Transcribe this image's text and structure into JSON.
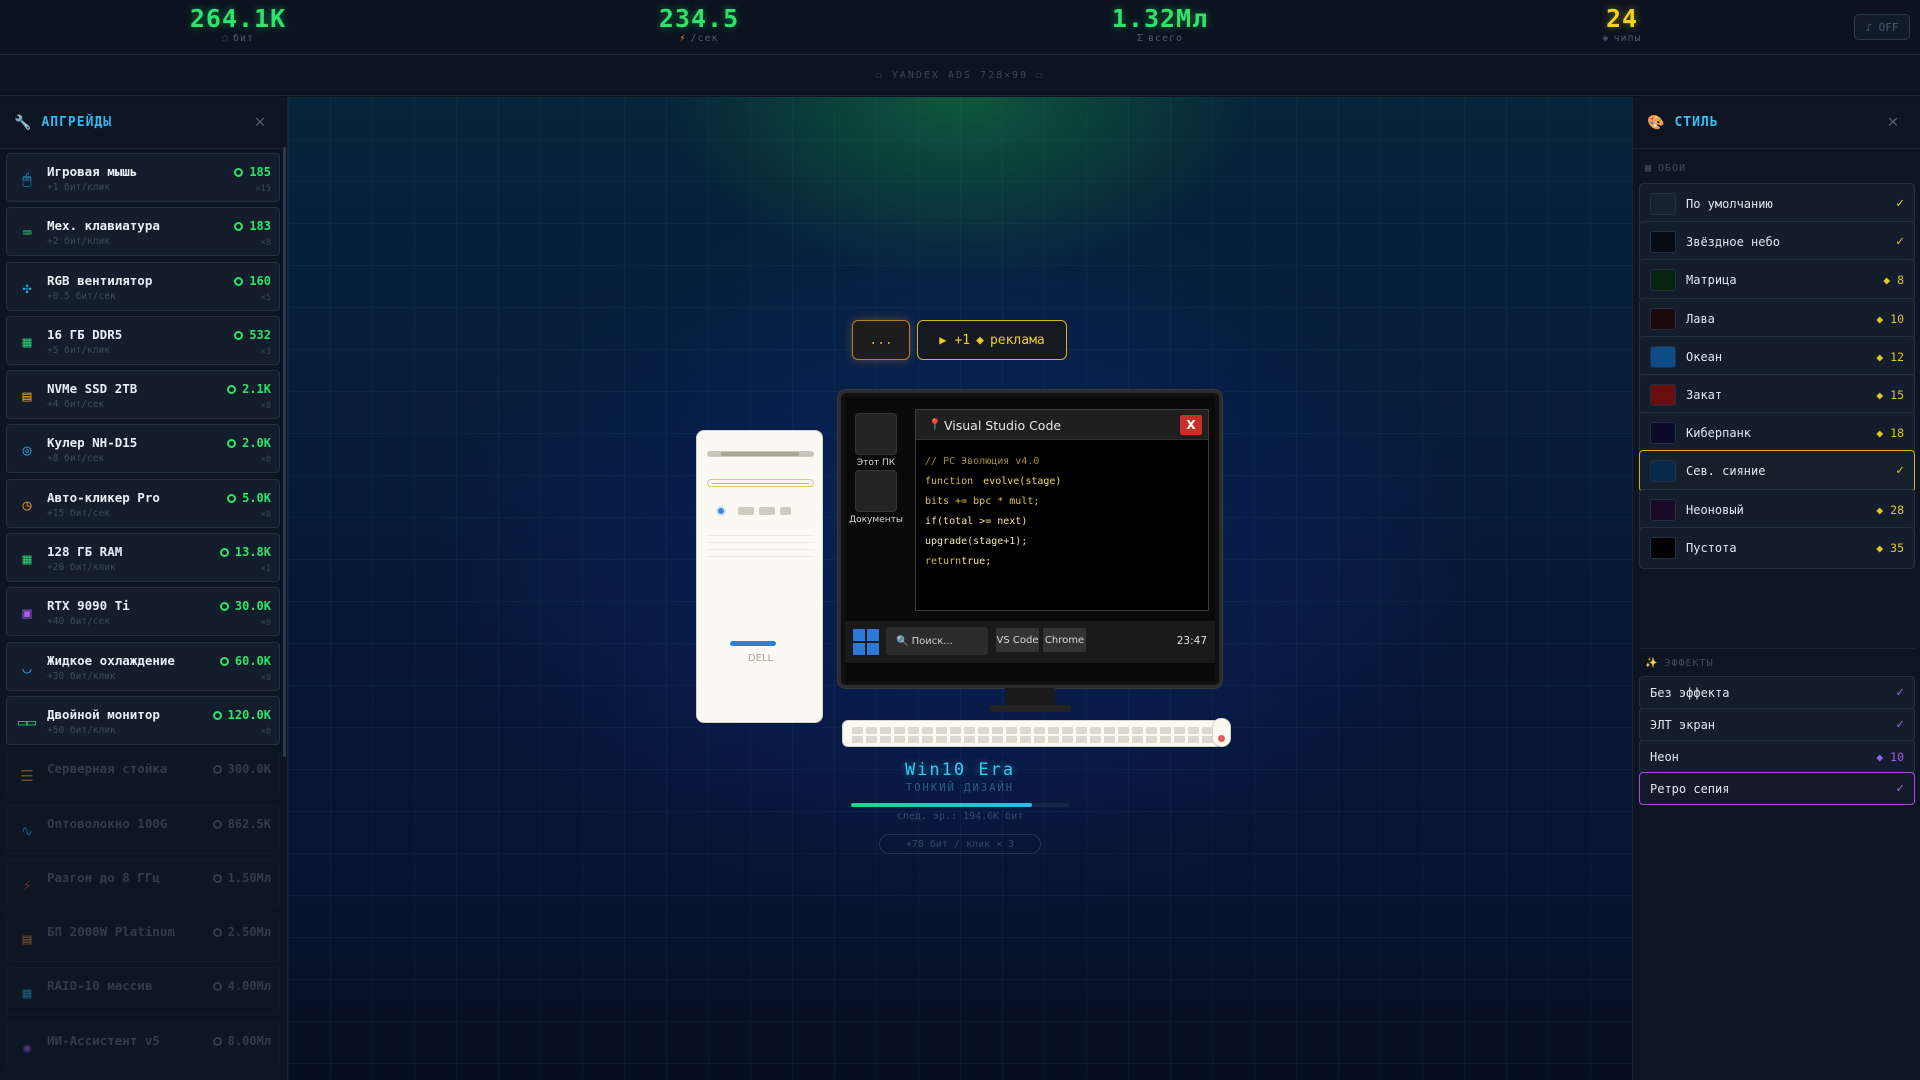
{
  "stats": [
    {
      "value": "264.1K",
      "icon": "◌",
      "label": "бит",
      "color": "#2fe36a"
    },
    {
      "value": "234.5",
      "icon": "⚡",
      "label": "/сек",
      "color": "#2fe36a"
    },
    {
      "value": "1.32Мл",
      "icon": "Σ",
      "label": "всего",
      "color": "#2fe36a"
    },
    {
      "value": "24",
      "icon": "◈",
      "label": "чипы",
      "color": "#f4d21c"
    }
  ],
  "off_button": "♪ OFF",
  "ad_banner": "☐ YANDEX ADS 728×90 ☐",
  "upgrades_panel": {
    "title": "АПГРЕЙДЫ",
    "icon": "wrench-icon",
    "items": [
      {
        "name": "Игровая мышь",
        "sub": "+1 бит/клик",
        "cost": "185",
        "owned": "×15",
        "icon": "mouse-icon",
        "icon_char": "🖱",
        "icon_color": "#2aa7e0",
        "locked": false
      },
      {
        "name": "Мех. клавиатура",
        "sub": "+2 бит/клик",
        "cost": "183",
        "owned": "×8",
        "icon": "keyboard-icon",
        "icon_char": "⌨",
        "icon_color": "#2fc06a",
        "locked": false
      },
      {
        "name": "RGB вентилятор",
        "sub": "+0.5 бит/сек",
        "cost": "160",
        "owned": "×5",
        "icon": "fan-icon",
        "icon_char": "✣",
        "icon_color": "#2aa7e0",
        "locked": false
      },
      {
        "name": "16 ГБ DDR5",
        "sub": "+5 бит/клик",
        "cost": "532",
        "owned": "×3",
        "icon": "ram-icon",
        "icon_char": "▦",
        "icon_color": "#2fc06a",
        "locked": false
      },
      {
        "name": "NVMe SSD 2TB",
        "sub": "+4 бит/сек",
        "cost": "2.1K",
        "owned": "×8",
        "icon": "ssd-icon",
        "icon_char": "▤",
        "icon_color": "#e8962a",
        "locked": false
      },
      {
        "name": "Кулер NH-D15",
        "sub": "+8 бит/сек",
        "cost": "2.0K",
        "owned": "×0",
        "icon": "cooler-icon",
        "icon_char": "◎",
        "icon_color": "#2aa7e0",
        "locked": false
      },
      {
        "name": "Авто-кликер Pro",
        "sub": "+15 бит/сек",
        "cost": "5.0K",
        "owned": "×0",
        "icon": "autoclicker-icon",
        "icon_char": "◷",
        "icon_color": "#e8962a",
        "locked": false
      },
      {
        "name": "128 ГБ RAM",
        "sub": "+20 бит/клик",
        "cost": "13.8K",
        "owned": "×1",
        "icon": "ram-icon",
        "icon_char": "▦",
        "icon_color": "#2fc06a",
        "locked": false
      },
      {
        "name": "RTX 9090 Ti",
        "sub": "+40 бит/сек",
        "cost": "30.0K",
        "owned": "×0",
        "icon": "gpu-icon",
        "icon_char": "▣",
        "icon_color": "#a65ce8",
        "locked": false
      },
      {
        "name": "Жидкое охлаждение",
        "sub": "+30 бит/клик",
        "cost": "60.0K",
        "owned": "×0",
        "icon": "liquid-cooling-icon",
        "icon_char": "◡",
        "icon_color": "#2aa7e0",
        "locked": false
      },
      {
        "name": "Двойной монитор",
        "sub": "+50 бит/клик",
        "cost": "120.0K",
        "owned": "×0",
        "icon": "dual-monitor-icon",
        "icon_char": "▭▭",
        "icon_color": "#2fc06a",
        "locked": false
      },
      {
        "name": "Серверная стойка",
        "sub": "",
        "cost": "300.0K",
        "owned": "",
        "icon": "server-rack-icon",
        "icon_char": "☰",
        "icon_color": "#e8962a",
        "locked": true
      },
      {
        "name": "Оптоволокно 100G",
        "sub": "",
        "cost": "862.5K",
        "owned": "",
        "icon": "fiber-icon",
        "icon_char": "∿",
        "icon_color": "#2aa7e0",
        "locked": true
      },
      {
        "name": "Разгон до 8 ГГц",
        "sub": "",
        "cost": "1.50Мл",
        "owned": "",
        "icon": "overclock-icon",
        "icon_char": "⚡",
        "icon_color": "#e84a4a",
        "locked": true
      },
      {
        "name": "БП 2000W Platinum",
        "sub": "",
        "cost": "2.50Мл",
        "owned": "",
        "icon": "psu-icon",
        "icon_char": "▤",
        "icon_color": "#e8962a",
        "locked": true
      },
      {
        "name": "RAID-10 массив",
        "sub": "",
        "cost": "4.00Мл",
        "owned": "",
        "icon": "raid-icon",
        "icon_char": "▦",
        "icon_color": "#2aa7e0",
        "locked": true
      },
      {
        "name": "ИИ-Ассистент v5",
        "sub": "",
        "cost": "8.00Мл",
        "owned": "",
        "icon": "ai-assistant-icon",
        "icon_char": "✺",
        "icon_color": "#a65ce8",
        "locked": true
      }
    ]
  },
  "style_panel": {
    "title": "СТИЛЬ",
    "icon": "palette-icon",
    "wallpapers_label": "ОБОИ",
    "effects_label": "ЭФФЕКТЫ",
    "wallpapers": [
      {
        "name": "По умолчанию",
        "status": "✓",
        "owned": true,
        "active": false,
        "swatch": "#162230"
      },
      {
        "name": "Звёздное небо",
        "status": "✓",
        "owned": true,
        "active": false,
        "swatch": "#070b16"
      },
      {
        "name": "Матрица",
        "status": "◆ 8",
        "owned": false,
        "active": false,
        "swatch": "#062410"
      },
      {
        "name": "Лава",
        "status": "◆ 10",
        "owned": false,
        "active": false,
        "swatch": "#1e0a0a"
      },
      {
        "name": "Океан",
        "status": "◆ 12",
        "owned": false,
        "active": false,
        "swatch": "#0f4b86"
      },
      {
        "name": "Закат",
        "status": "◆ 15",
        "owned": false,
        "active": false,
        "swatch": "#6a0f0f"
      },
      {
        "name": "Киберпанк",
        "status": "◆ 18",
        "owned": false,
        "active": false,
        "swatch": "#0e0a2a"
      },
      {
        "name": "Сев. сияние",
        "status": "✓",
        "owned": true,
        "active": true,
        "swatch": "#0a2a4a"
      },
      {
        "name": "Неоновый",
        "status": "◆ 28",
        "owned": false,
        "active": false,
        "swatch": "#1a0a2a"
      },
      {
        "name": "Пустота",
        "status": "◆ 35",
        "owned": false,
        "active": false,
        "swatch": "#020202"
      }
    ],
    "effects": [
      {
        "name": "Без эффекта",
        "status": "✓",
        "owned": true,
        "active": false
      },
      {
        "name": "ЭЛТ экран",
        "status": "✓",
        "owned": true,
        "active": false
      },
      {
        "name": "Неон",
        "status": "◆ 10",
        "owned": false,
        "active": false
      },
      {
        "name": "Ретро сепия",
        "status": "✓",
        "owned": true,
        "active": true
      }
    ]
  },
  "center": {
    "dots_button": "...",
    "ad_button": {
      "prefix": "+1",
      "gem": "◆",
      "label": "реклама"
    },
    "tower_brand": "DELL",
    "desktop_icons": [
      "Этот ПК",
      "Документы"
    ],
    "window_title": "Visual Studio Code",
    "window_close": "X",
    "code_lines": [
      {
        "parts": [
          {
            "t": "// PC Эволюция v4.0",
            "c": "cm"
          }
        ]
      },
      {
        "parts": [
          {
            "t": "function",
            "c": "kw"
          },
          {
            "t": "evolve(stage)",
            "c": "id"
          }
        ]
      },
      {
        "parts": [
          {
            "t": "bits += bpc * mult;",
            "c": "c"
          }
        ]
      },
      {
        "parts": [
          {
            "t": "if(total >= next)",
            "c": "wh"
          }
        ]
      },
      {
        "parts": [
          {
            "t": "upgrade(stage+1);",
            "c": "wh"
          }
        ]
      },
      {
        "parts": [
          {
            "t": "return",
            "c": "kw"
          },
          {
            "t": "true;",
            "c": "wh"
          }
        ]
      }
    ],
    "taskbar": {
      "search": "🔍 Поиск...",
      "apps": [
        "VS Code",
        "Chrome"
      ],
      "clock": "23:47"
    },
    "era_title": "Win10 Era",
    "era_subtitle": "ТОНКИЙ ДИЗАЙН",
    "era_progress": 0.83,
    "next_label": "след. эр.: 194.6K бит",
    "click_info": "+78 бит / клик × 3"
  }
}
